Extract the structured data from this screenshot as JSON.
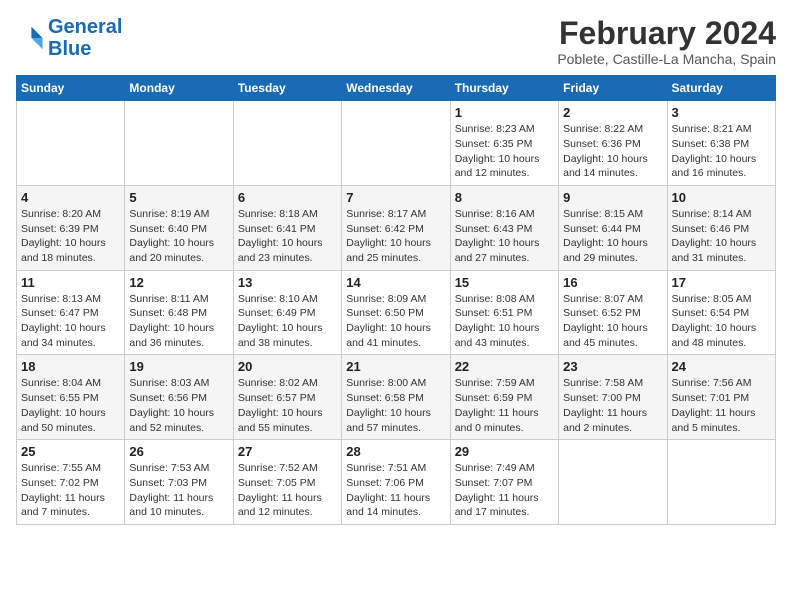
{
  "header": {
    "logo_line1": "General",
    "logo_line2": "Blue",
    "title": "February 2024",
    "subtitle": "Poblete, Castille-La Mancha, Spain"
  },
  "days_of_week": [
    "Sunday",
    "Monday",
    "Tuesday",
    "Wednesday",
    "Thursday",
    "Friday",
    "Saturday"
  ],
  "weeks": [
    [
      {
        "day": "",
        "info": ""
      },
      {
        "day": "",
        "info": ""
      },
      {
        "day": "",
        "info": ""
      },
      {
        "day": "",
        "info": ""
      },
      {
        "day": "1",
        "info": "Sunrise: 8:23 AM\nSunset: 6:35 PM\nDaylight: 10 hours\nand 12 minutes."
      },
      {
        "day": "2",
        "info": "Sunrise: 8:22 AM\nSunset: 6:36 PM\nDaylight: 10 hours\nand 14 minutes."
      },
      {
        "day": "3",
        "info": "Sunrise: 8:21 AM\nSunset: 6:38 PM\nDaylight: 10 hours\nand 16 minutes."
      }
    ],
    [
      {
        "day": "4",
        "info": "Sunrise: 8:20 AM\nSunset: 6:39 PM\nDaylight: 10 hours\nand 18 minutes."
      },
      {
        "day": "5",
        "info": "Sunrise: 8:19 AM\nSunset: 6:40 PM\nDaylight: 10 hours\nand 20 minutes."
      },
      {
        "day": "6",
        "info": "Sunrise: 8:18 AM\nSunset: 6:41 PM\nDaylight: 10 hours\nand 23 minutes."
      },
      {
        "day": "7",
        "info": "Sunrise: 8:17 AM\nSunset: 6:42 PM\nDaylight: 10 hours\nand 25 minutes."
      },
      {
        "day": "8",
        "info": "Sunrise: 8:16 AM\nSunset: 6:43 PM\nDaylight: 10 hours\nand 27 minutes."
      },
      {
        "day": "9",
        "info": "Sunrise: 8:15 AM\nSunset: 6:44 PM\nDaylight: 10 hours\nand 29 minutes."
      },
      {
        "day": "10",
        "info": "Sunrise: 8:14 AM\nSunset: 6:46 PM\nDaylight: 10 hours\nand 31 minutes."
      }
    ],
    [
      {
        "day": "11",
        "info": "Sunrise: 8:13 AM\nSunset: 6:47 PM\nDaylight: 10 hours\nand 34 minutes."
      },
      {
        "day": "12",
        "info": "Sunrise: 8:11 AM\nSunset: 6:48 PM\nDaylight: 10 hours\nand 36 minutes."
      },
      {
        "day": "13",
        "info": "Sunrise: 8:10 AM\nSunset: 6:49 PM\nDaylight: 10 hours\nand 38 minutes."
      },
      {
        "day": "14",
        "info": "Sunrise: 8:09 AM\nSunset: 6:50 PM\nDaylight: 10 hours\nand 41 minutes."
      },
      {
        "day": "15",
        "info": "Sunrise: 8:08 AM\nSunset: 6:51 PM\nDaylight: 10 hours\nand 43 minutes."
      },
      {
        "day": "16",
        "info": "Sunrise: 8:07 AM\nSunset: 6:52 PM\nDaylight: 10 hours\nand 45 minutes."
      },
      {
        "day": "17",
        "info": "Sunrise: 8:05 AM\nSunset: 6:54 PM\nDaylight: 10 hours\nand 48 minutes."
      }
    ],
    [
      {
        "day": "18",
        "info": "Sunrise: 8:04 AM\nSunset: 6:55 PM\nDaylight: 10 hours\nand 50 minutes."
      },
      {
        "day": "19",
        "info": "Sunrise: 8:03 AM\nSunset: 6:56 PM\nDaylight: 10 hours\nand 52 minutes."
      },
      {
        "day": "20",
        "info": "Sunrise: 8:02 AM\nSunset: 6:57 PM\nDaylight: 10 hours\nand 55 minutes."
      },
      {
        "day": "21",
        "info": "Sunrise: 8:00 AM\nSunset: 6:58 PM\nDaylight: 10 hours\nand 57 minutes."
      },
      {
        "day": "22",
        "info": "Sunrise: 7:59 AM\nSunset: 6:59 PM\nDaylight: 11 hours\nand 0 minutes."
      },
      {
        "day": "23",
        "info": "Sunrise: 7:58 AM\nSunset: 7:00 PM\nDaylight: 11 hours\nand 2 minutes."
      },
      {
        "day": "24",
        "info": "Sunrise: 7:56 AM\nSunset: 7:01 PM\nDaylight: 11 hours\nand 5 minutes."
      }
    ],
    [
      {
        "day": "25",
        "info": "Sunrise: 7:55 AM\nSunset: 7:02 PM\nDaylight: 11 hours\nand 7 minutes."
      },
      {
        "day": "26",
        "info": "Sunrise: 7:53 AM\nSunset: 7:03 PM\nDaylight: 11 hours\nand 10 minutes."
      },
      {
        "day": "27",
        "info": "Sunrise: 7:52 AM\nSunset: 7:05 PM\nDaylight: 11 hours\nand 12 minutes."
      },
      {
        "day": "28",
        "info": "Sunrise: 7:51 AM\nSunset: 7:06 PM\nDaylight: 11 hours\nand 14 minutes."
      },
      {
        "day": "29",
        "info": "Sunrise: 7:49 AM\nSunset: 7:07 PM\nDaylight: 11 hours\nand 17 minutes."
      },
      {
        "day": "",
        "info": ""
      },
      {
        "day": "",
        "info": ""
      }
    ]
  ]
}
